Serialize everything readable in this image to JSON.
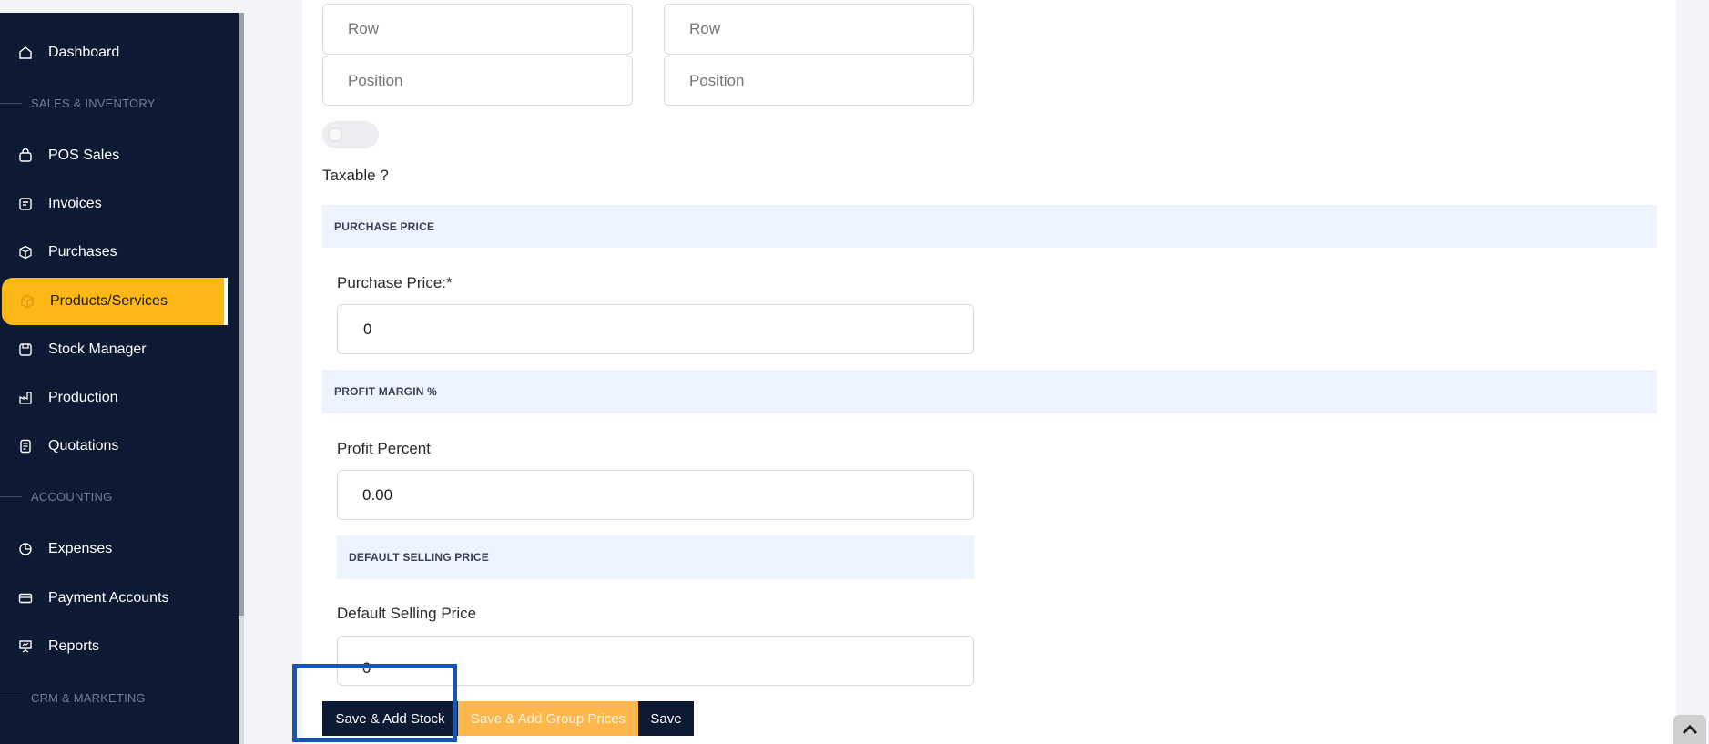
{
  "sidebar": {
    "items": [
      {
        "label": "Dashboard",
        "icon": "home-icon"
      },
      {
        "label": "POS Sales",
        "icon": "bag-icon"
      },
      {
        "label": "Invoices",
        "icon": "invoice-icon"
      },
      {
        "label": "Purchases",
        "icon": "box-icon"
      },
      {
        "label": "Products/Services",
        "icon": "cube-icon",
        "active": true
      },
      {
        "label": "Stock Manager",
        "icon": "stock-icon"
      },
      {
        "label": "Production",
        "icon": "factory-icon"
      },
      {
        "label": "Quotations",
        "icon": "quotation-icon"
      },
      {
        "label": "Expenses",
        "icon": "pie-icon"
      },
      {
        "label": "Payment Accounts",
        "icon": "wallet-icon"
      },
      {
        "label": "Reports",
        "icon": "presentation-icon"
      }
    ],
    "sections": [
      "SALES & INVENTORY",
      "ACCOUNTING",
      "CRM & MARKETING"
    ]
  },
  "form": {
    "row_placeholder": "Row",
    "position_placeholder": "Position",
    "taxable_label": "Taxable ?",
    "purchase_section": "PURCHASE PRICE",
    "purchase_label": "Purchase Price:*",
    "purchase_value": "0",
    "profit_section": "PROFIT MARGIN %",
    "profit_label": "Profit Percent",
    "profit_value": "0.00",
    "default_section": "DEFAULT SELLING PRICE",
    "default_label": "Default Selling Price",
    "default_value": "0"
  },
  "actions": {
    "save_add_stock": "Save & Add Stock",
    "save_add_group": "Save & Add Group Prices",
    "save": "Save"
  },
  "colors": {
    "sidebar_bg": "#0d1a33",
    "accent": "#fdb716",
    "band_bg": "#edf4ff",
    "highlight": "#1656b5"
  }
}
